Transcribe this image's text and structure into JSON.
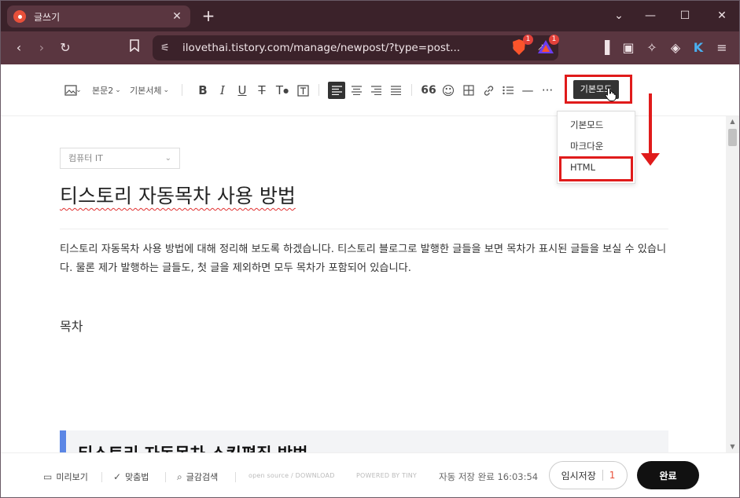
{
  "browser": {
    "tab_title": "글쓰기",
    "new_tab": "+",
    "close_tab": "✕",
    "url": "ilovethai.tistory.com/manage/newpost/?type=post...",
    "brave_badge": "1",
    "rewards_badge": "1"
  },
  "toolbar": {
    "paragraph_style": "본문2",
    "font_family": "기본서체",
    "mode_button": "기본모드"
  },
  "mode_menu": {
    "items": [
      "기본모드",
      "마크다운",
      "HTML"
    ]
  },
  "editor": {
    "category": "컴퓨터 IT",
    "title": "티스토리 자동목차 사용 방법",
    "paragraph": "티스토리 자동목차 사용 방법에 대해 정리해 보도록 하겠습니다. 티스토리 블로그로 발행한 글들을 보면 목차가 표시된 글들을 보실 수 있습니다. 물론 제가 발행하는 글들도, 첫 글을 제외하면 모두 목차가 포함되어 있습니다.",
    "toc_heading": "목차",
    "heading2": "티스토리 자동목차 스킨편집 방법"
  },
  "footer": {
    "preview": "미리보기",
    "spellcheck": "맞춤법",
    "search": "글감검색",
    "open_source": "open source / DOWNLOAD",
    "powered": "POWERED BY TINY",
    "autosave": "자동 저장 완료 16:03:54",
    "draft_label": "임시저장",
    "draft_count": "1",
    "publish": "완료"
  },
  "colors": {
    "highlight": "#e01b1b",
    "heading_bar": "#5b86e5",
    "tab_bar": "#3b222a",
    "nav_bar": "#5a3640"
  }
}
